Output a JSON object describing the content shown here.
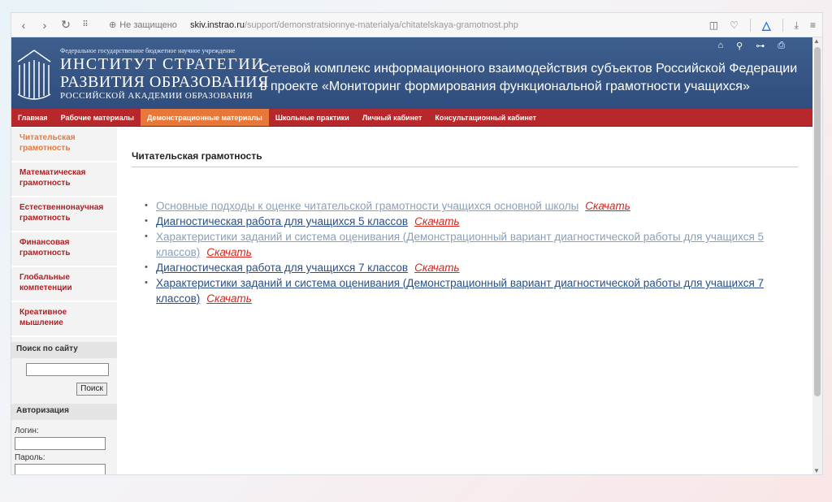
{
  "browser": {
    "security": "Не защищено",
    "url_host": "skiv.instrao.ru",
    "url_path": "/support/demonstratsionnye-materialya/chitatelskaya-gramotnost.php"
  },
  "header": {
    "org_small": "Федеральное государственное бюджетное научное учреждение",
    "org_line1": "ИНСТИТУТ СТРАТЕГИИ",
    "org_line2": "РАЗВИТИЯ ОБРАЗОВАНИЯ",
    "org_line3": "РОССИЙСКОЙ АКАДЕМИИ ОБРАЗОВАНИЯ",
    "site_title": "Сетевой комплекс информационного взаимодействия субъектов Российской Федерации в проекте «Мониторинг формирования функциональной грамотности учащихся»"
  },
  "nav": {
    "items": [
      {
        "label": "Главная"
      },
      {
        "label": "Рабочие материалы"
      },
      {
        "label": "Демонстрационные материалы"
      },
      {
        "label": "Школьные практики"
      },
      {
        "label": "Личный кабинет"
      },
      {
        "label": "Консультационный кабинет"
      }
    ]
  },
  "sidebar": {
    "items": [
      {
        "label": "Читательская грамотность"
      },
      {
        "label": "Математическая грамотность"
      },
      {
        "label": "Естественнонаучная грамотность"
      },
      {
        "label": "Финансовая грамотность"
      },
      {
        "label": "Глобальные компетенции"
      },
      {
        "label": "Креативное мышление"
      }
    ],
    "search_title": "Поиск по сайту",
    "search_button": "Поиск",
    "auth_title": "Авторизация",
    "login_label": "Логин:",
    "password_label": "Пароль:"
  },
  "main": {
    "heading": "Читательская грамотность",
    "download_label": "Скачать",
    "docs": [
      {
        "title": "Основные подходы к оценке читательской грамотности учащихся основной школы"
      },
      {
        "title": "Диагностическая работа для учащихся 5 классов"
      },
      {
        "title": "Характеристики заданий и система оценивания (Демонстрационный вариант диагностической работы для учащихся 5 классов)"
      },
      {
        "title": "Диагностическая работа для учащихся 7 классов"
      },
      {
        "title": "Характеристики заданий и система оценивания (Демонстрационный вариант диагностической работы для учащихся 7 классов)"
      }
    ]
  },
  "colors": {
    "header_bg": "#2f4e7e",
    "nav_bg": "#b6282c",
    "nav_active": "#e8783a",
    "link": "#2a4f86",
    "download": "#d8261d"
  }
}
